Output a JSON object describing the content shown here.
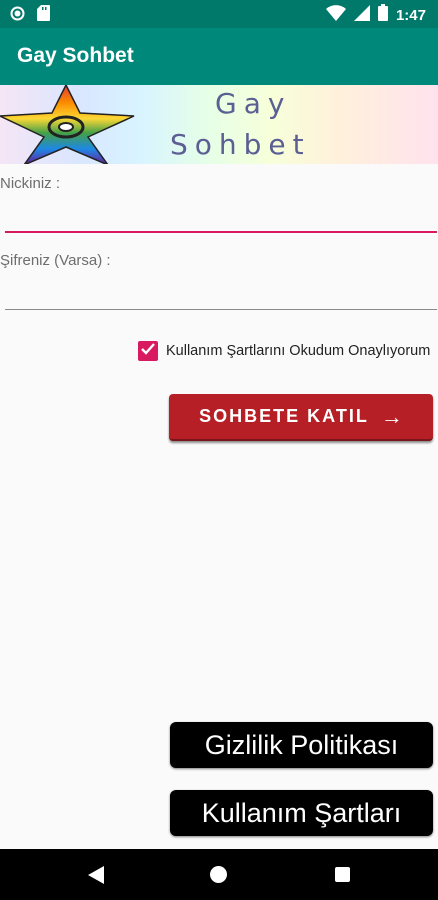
{
  "status_bar": {
    "time": "1:47"
  },
  "app_bar": {
    "title": "Gay Sohbet"
  },
  "banner": {
    "word1": "Gay",
    "word2": "Sohbet"
  },
  "form": {
    "nick_label": "Nickiniz :",
    "nick_value": "",
    "password_label": "Şifreniz (Varsa) :",
    "password_value": "",
    "terms_checkbox_label": "Kullanım Şartlarını Okudum Onaylıyorum",
    "terms_checked": true,
    "join_button_label": "SOHBETE KATIL",
    "join_button_arrow": "→"
  },
  "footer_buttons": {
    "privacy_label": "Gizlilik Politikası",
    "terms_label": "Kullanım Şartları"
  },
  "colors": {
    "app_bar": "#00897b",
    "status_bar": "#00796b",
    "accent": "#d81b60",
    "join_button": "#b51f25"
  },
  "icons": [
    "circle-status-icon",
    "sd-card-icon",
    "wifi-icon",
    "signal-icon",
    "battery-icon",
    "back-icon",
    "home-icon",
    "recents-icon",
    "check-icon",
    "rainbow-star-icon"
  ]
}
